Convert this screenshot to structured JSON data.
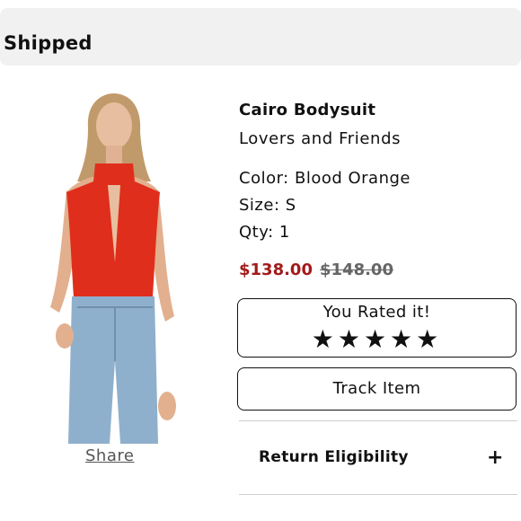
{
  "header": {
    "status": "Shipped"
  },
  "product": {
    "name": "Cairo Bodysuit",
    "brand": "Lovers and Friends",
    "color": "Color: Blood Orange",
    "size": "Size: S",
    "qty": "Qty: 1",
    "price_sale": "$138.00",
    "price_original": "$148.00",
    "share": "Share"
  },
  "rating": {
    "title": "You Rated it!",
    "stars": "★★★★★",
    "value": 5,
    "max": 5
  },
  "actions": {
    "track": "Track Item"
  },
  "return": {
    "label": "Return Eligibility",
    "icon": "plus-icon"
  },
  "colors": {
    "sale": "#a11b1b",
    "header_bg": "#f1f1f1",
    "top": "#e02e1c",
    "jeans": "#8fb0cc"
  }
}
